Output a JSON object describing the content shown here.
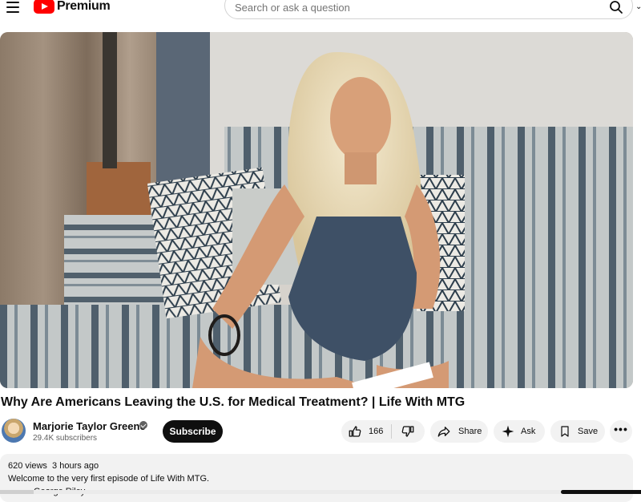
{
  "header": {
    "logo_text": "Premium",
    "search_placeholder": "Search or ask a question"
  },
  "video": {
    "title": "Why Are Americans Leaving the U.S. for Medical Treatment? | Life With MTG"
  },
  "channel": {
    "name": "Marjorie Taylor Greene",
    "subscribers": "29.4K subscribers",
    "subscribe_label": "Subscribe"
  },
  "actions": {
    "like_count": "166",
    "share_label": "Share",
    "ask_label": "Ask",
    "save_label": "Save",
    "more_label": "•••"
  },
  "description": {
    "views": "620 views",
    "age": "3 hours ago",
    "text": "Welcome to the very first episode of Life With MTG.",
    "partial_text": "George Riley"
  },
  "colors": {
    "brand_red": "#ff0000",
    "subscribe_bg": "#0f0f0f",
    "pill_bg": "#f2f2f2"
  }
}
